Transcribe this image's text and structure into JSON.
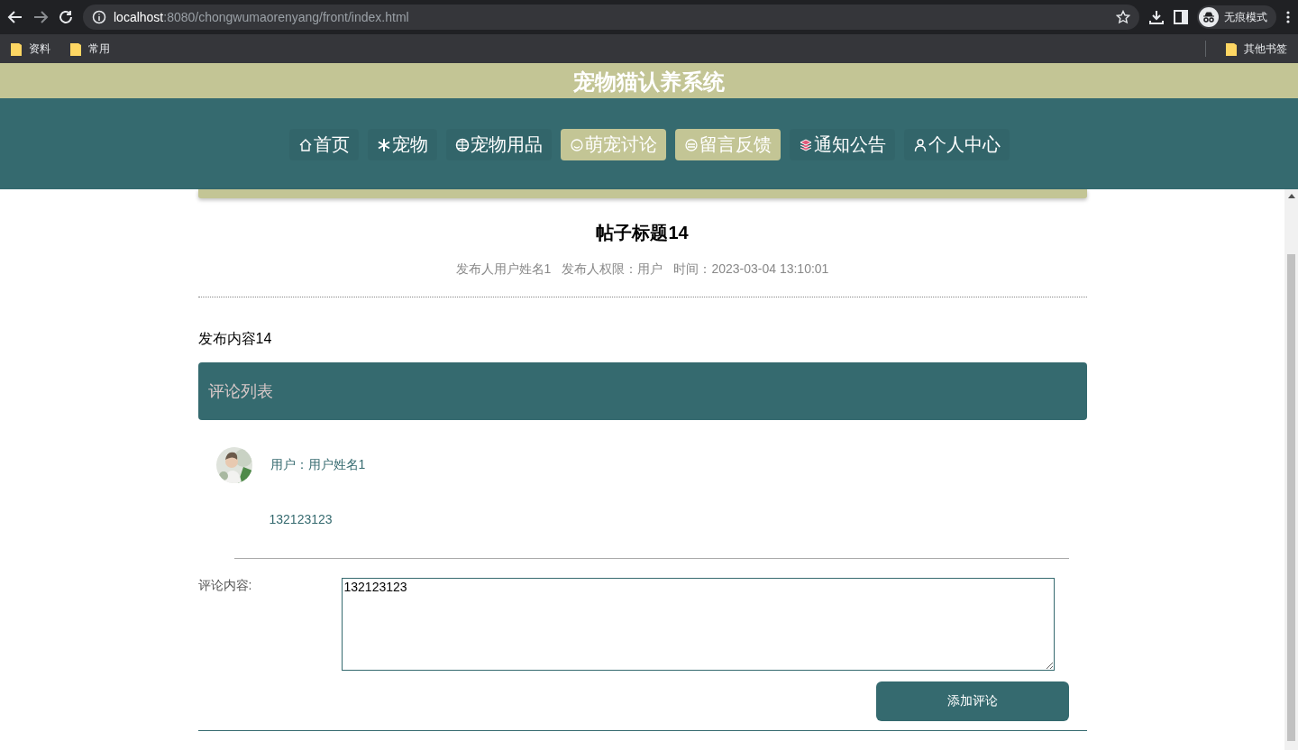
{
  "browser": {
    "url_host": "localhost",
    "url_path": ":8080/chongwumaorenyang/front/index.html",
    "profile": "无痕模式",
    "bookmarks": [
      "资料",
      "常用"
    ],
    "other_bookmarks": "其他书签"
  },
  "site": {
    "title": "宠物猫认养系统"
  },
  "nav": [
    {
      "label": "首页",
      "highlighted": false
    },
    {
      "label": "宠物",
      "highlighted": false
    },
    {
      "label": "宠物用品",
      "highlighted": false
    },
    {
      "label": "萌宠讨论",
      "highlighted": true
    },
    {
      "label": "留言反馈",
      "highlighted": true
    },
    {
      "label": "通知公告",
      "highlighted": false
    },
    {
      "label": "个人中心",
      "highlighted": false
    }
  ],
  "post": {
    "title": "帖子标题14",
    "author": "发布人用户姓名1",
    "role": "发布人权限：用户",
    "time": "时间：2023-03-04 13:10:01",
    "content": "发布内容14"
  },
  "comments_header": "评论列表",
  "comments": [
    {
      "user": "用户：用户姓名1",
      "text": "132123123"
    }
  ],
  "comment_form": {
    "label": "评论内容:",
    "value": "132123123",
    "button": "添加评论"
  }
}
